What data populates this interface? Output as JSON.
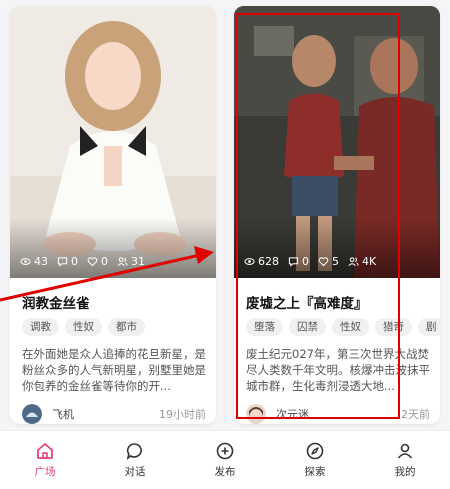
{
  "colors": {
    "accent": "#e8437a",
    "highlight_box": "#e00000",
    "tag_bg": "#f0f0f2"
  },
  "cards": [
    {
      "cover_icon": "anime-girl-maid-illustration",
      "stats": {
        "views": "43",
        "comments": "0",
        "likes": "0",
        "users": "31"
      },
      "title": "润教金丝雀",
      "tags": [
        "调教",
        "性奴",
        "都市"
      ],
      "description": "在外面她是众人追捧的花旦新星，是粉丝众多的人气新明星，别墅里她是你包养的金丝雀等待你的开...",
      "author": "飞机",
      "time": "19小时前"
    },
    {
      "cover_icon": "post-apocalypse-illustration",
      "stats": {
        "views": "628",
        "comments": "0",
        "likes": "5",
        "users": "4K"
      },
      "title": "废墟之上『高难度』",
      "tags": [
        "堕落",
        "囚禁",
        "性奴",
        "猎奇",
        "剧"
      ],
      "description": "废土纪元027年，第三次世界大战焚尽人类数千年文明。核爆冲击波抹平城市群，生化毒剂浸透大地...",
      "author": "次元迷",
      "time": "2天前"
    }
  ],
  "tabs": [
    {
      "label": "广场",
      "icon": "home-icon",
      "active": true
    },
    {
      "label": "对话",
      "icon": "chat-bubble-icon",
      "active": false
    },
    {
      "label": "发布",
      "icon": "plus-circle-icon",
      "active": false
    },
    {
      "label": "探索",
      "icon": "compass-icon",
      "active": false
    },
    {
      "label": "我的",
      "icon": "user-icon",
      "active": false
    }
  ]
}
